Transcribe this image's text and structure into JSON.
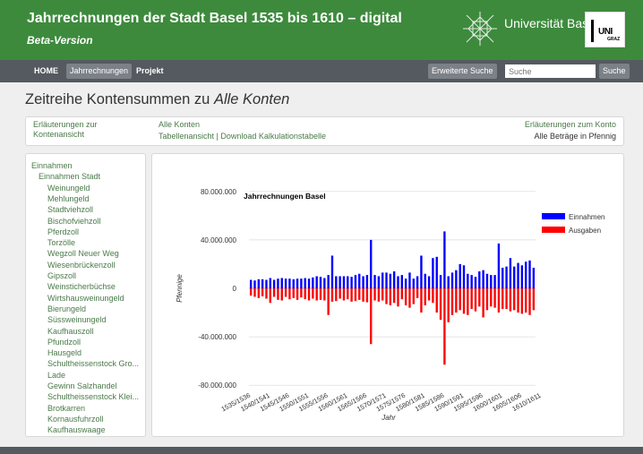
{
  "header": {
    "title": "Jahrrechnungen der Stadt Basel 1535 bis 1610 – digital",
    "subtitle": "Beta-Version",
    "uni_logo": "Universität Basel",
    "graz_logo_uni": "UNI",
    "graz_logo_city": "GRAZ"
  },
  "nav": {
    "home": "HOME",
    "jahrrechnungen": "Jahrrechnungen",
    "projekt": "Projekt",
    "advanced_search": "Erweiterte Suche",
    "search_placeholder": "Suche",
    "search_button": "Suche"
  },
  "page": {
    "title_prefix": "Zeitreihe Kontensummen zu ",
    "title_emph": "Alle Konten"
  },
  "info": {
    "left": "Erläuterungen zur Kontenansicht",
    "account": "Alle Konten",
    "links": "Tabellenansicht | Download Kalkulationstabelle",
    "right_link": "Erläuterungen zum Konto",
    "right_note": "Alle Beträge in Pfennig"
  },
  "sidebar": {
    "items": [
      {
        "label": "Einnahmen",
        "level": 0
      },
      {
        "label": "Einnahmen Stadt",
        "level": 1
      },
      {
        "label": "Weinungeld",
        "level": 2
      },
      {
        "label": "Mehlungeld",
        "level": 2
      },
      {
        "label": "Stadtviehzoll",
        "level": 2
      },
      {
        "label": "Bischofviehzoll",
        "level": 2
      },
      {
        "label": "Pferdzoll",
        "level": 2
      },
      {
        "label": "Torzölle",
        "level": 2
      },
      {
        "label": "Wegzoll Neuer Weg",
        "level": 2
      },
      {
        "label": "Wiesenbrückenzoll",
        "level": 2
      },
      {
        "label": "Gipszoll",
        "level": 2
      },
      {
        "label": "Weinsticherbüchse",
        "level": 2
      },
      {
        "label": "Wirtshausweinungeld",
        "level": 2
      },
      {
        "label": "Bierungeld",
        "level": 2
      },
      {
        "label": "Süssweinungeld",
        "level": 2
      },
      {
        "label": "Kaufhauszoll",
        "level": 2
      },
      {
        "label": "Pfundzoll",
        "level": 2
      },
      {
        "label": "Hausgeld",
        "level": 2
      },
      {
        "label": "Schultheissenstock Gro...",
        "level": 2
      },
      {
        "label": "Lade",
        "level": 2
      },
      {
        "label": "Gewinn Salzhandel",
        "level": 2
      },
      {
        "label": "Schultheissenstock Klei...",
        "level": 2
      },
      {
        "label": "Brotkarren",
        "level": 2
      },
      {
        "label": "Kornausfuhrzoll",
        "level": 2
      },
      {
        "label": "Kaufhauswaage",
        "level": 2
      }
    ]
  },
  "chart_data": {
    "type": "bar",
    "title": "Jahrrechnungen Basel",
    "xlabel": "Jahr",
    "ylabel": "Pfennige",
    "ylim": [
      -85000000,
      85000000
    ],
    "yticks": [
      80000000,
      40000000,
      0,
      -40000000,
      -80000000
    ],
    "ytick_labels": [
      "80.000.000",
      "40.000.000",
      "0",
      "-40.000.000",
      "-80.000.000"
    ],
    "xtick_labels": [
      "1535/1536",
      "1540/1541",
      "1545/1546",
      "1550/1551",
      "1555/1556",
      "1560/1561",
      "1565/1566",
      "1570/1571",
      "1575/1576",
      "1580/1581",
      "1585/1586",
      "1590/1591",
      "1595/1596",
      "1600/1601",
      "1605/1606",
      "1610/1611"
    ],
    "xtick_every": 5,
    "grid": true,
    "legend_position": "top-right",
    "series": [
      {
        "name": "Einnahmen",
        "color": "#0000ff",
        "values": [
          7000000,
          6500000,
          7500000,
          7500000,
          7000000,
          8500000,
          7000000,
          8000000,
          8500000,
          8000000,
          8000000,
          7500000,
          8000000,
          8000000,
          8500000,
          8000000,
          9000000,
          10000000,
          9500000,
          8500000,
          11000000,
          27000000,
          10000000,
          10000000,
          10000000,
          10000000,
          9500000,
          11000000,
          12000000,
          10000000,
          11000000,
          40000000,
          11000000,
          10000000,
          13000000,
          13000000,
          12000000,
          14000000,
          10000000,
          11000000,
          8000000,
          13000000,
          8000000,
          10000000,
          27000000,
          12000000,
          10000000,
          25000000,
          26000000,
          11000000,
          47000000,
          10000000,
          13000000,
          15000000,
          20000000,
          19000000,
          12000000,
          11000000,
          9500000,
          14000000,
          15000000,
          12000000,
          11000000,
          11000000,
          37000000,
          17000000,
          18000000,
          25000000,
          18000000,
          21000000,
          19000000,
          22000000,
          23000000,
          17000000
        ]
      },
      {
        "name": "Ausgaben",
        "color": "#ff0000",
        "values": [
          -6000000,
          -7000000,
          -8000000,
          -6500000,
          -8500000,
          -12000000,
          -7000000,
          -9500000,
          -10000000,
          -7000000,
          -9000000,
          -8000000,
          -9500000,
          -7500000,
          -9000000,
          -10000000,
          -8500000,
          -10000000,
          -9500000,
          -10000000,
          -22000000,
          -11000000,
          -10500000,
          -8500000,
          -10000000,
          -9000000,
          -11000000,
          -10500000,
          -9500000,
          -11000000,
          -11500000,
          -46000000,
          -10000000,
          -11000000,
          -10000000,
          -13000000,
          -14000000,
          -12000000,
          -15000000,
          -9000000,
          -14000000,
          -16000000,
          -13000000,
          -8000000,
          -20000000,
          -14000000,
          -10000000,
          -12000000,
          -20000000,
          -26000000,
          -63000000,
          -28000000,
          -22000000,
          -20000000,
          -18000000,
          -21000000,
          -22000000,
          -17000000,
          -19000000,
          -15000000,
          -24000000,
          -18000000,
          -15000000,
          -16000000,
          -20000000,
          -17000000,
          -17000000,
          -19000000,
          -18000000,
          -20000000,
          -21000000,
          -20000000,
          -22000000,
          -18000000
        ]
      }
    ]
  }
}
